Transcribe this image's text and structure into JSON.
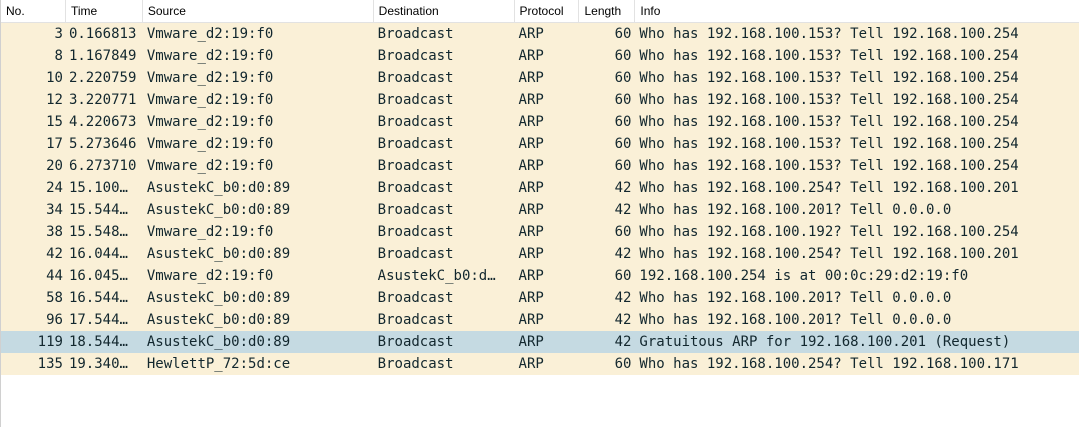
{
  "columns": {
    "no": "No.",
    "time": "Time",
    "source": "Source",
    "destination": "Destination",
    "protocol": "Protocol",
    "length": "Length",
    "info": "Info"
  },
  "packets": [
    {
      "no": "3",
      "time": "0.166813",
      "source": "Vmware_d2:19:f0",
      "destination": "Broadcast",
      "protocol": "ARP",
      "length": "60",
      "info": "Who has 192.168.100.153? Tell 192.168.100.254"
    },
    {
      "no": "8",
      "time": "1.167849",
      "source": "Vmware_d2:19:f0",
      "destination": "Broadcast",
      "protocol": "ARP",
      "length": "60",
      "info": "Who has 192.168.100.153? Tell 192.168.100.254"
    },
    {
      "no": "10",
      "time": "2.220759",
      "source": "Vmware_d2:19:f0",
      "destination": "Broadcast",
      "protocol": "ARP",
      "length": "60",
      "info": "Who has 192.168.100.153? Tell 192.168.100.254"
    },
    {
      "no": "12",
      "time": "3.220771",
      "source": "Vmware_d2:19:f0",
      "destination": "Broadcast",
      "protocol": "ARP",
      "length": "60",
      "info": "Who has 192.168.100.153? Tell 192.168.100.254"
    },
    {
      "no": "15",
      "time": "4.220673",
      "source": "Vmware_d2:19:f0",
      "destination": "Broadcast",
      "protocol": "ARP",
      "length": "60",
      "info": "Who has 192.168.100.153? Tell 192.168.100.254"
    },
    {
      "no": "17",
      "time": "5.273646",
      "source": "Vmware_d2:19:f0",
      "destination": "Broadcast",
      "protocol": "ARP",
      "length": "60",
      "info": "Who has 192.168.100.153? Tell 192.168.100.254"
    },
    {
      "no": "20",
      "time": "6.273710",
      "source": "Vmware_d2:19:f0",
      "destination": "Broadcast",
      "protocol": "ARP",
      "length": "60",
      "info": "Who has 192.168.100.153? Tell 192.168.100.254"
    },
    {
      "no": "24",
      "time": "15.100…",
      "source": "AsustekC_b0:d0:89",
      "destination": "Broadcast",
      "protocol": "ARP",
      "length": "42",
      "info": "Who has 192.168.100.254? Tell 192.168.100.201"
    },
    {
      "no": "34",
      "time": "15.544…",
      "source": "AsustekC_b0:d0:89",
      "destination": "Broadcast",
      "protocol": "ARP",
      "length": "42",
      "info": "Who has 192.168.100.201? Tell 0.0.0.0"
    },
    {
      "no": "38",
      "time": "15.548…",
      "source": "Vmware_d2:19:f0",
      "destination": "Broadcast",
      "protocol": "ARP",
      "length": "60",
      "info": "Who has 192.168.100.192? Tell 192.168.100.254"
    },
    {
      "no": "42",
      "time": "16.044…",
      "source": "AsustekC_b0:d0:89",
      "destination": "Broadcast",
      "protocol": "ARP",
      "length": "42",
      "info": "Who has 192.168.100.254? Tell 192.168.100.201"
    },
    {
      "no": "44",
      "time": "16.045…",
      "source": "Vmware_d2:19:f0",
      "destination": "AsustekC_b0:d…",
      "protocol": "ARP",
      "length": "60",
      "info": "192.168.100.254 is at 00:0c:29:d2:19:f0"
    },
    {
      "no": "58",
      "time": "16.544…",
      "source": "AsustekC_b0:d0:89",
      "destination": "Broadcast",
      "protocol": "ARP",
      "length": "42",
      "info": "Who has 192.168.100.201? Tell 0.0.0.0"
    },
    {
      "no": "96",
      "time": "17.544…",
      "source": "AsustekC_b0:d0:89",
      "destination": "Broadcast",
      "protocol": "ARP",
      "length": "42",
      "info": "Who has 192.168.100.201? Tell 0.0.0.0"
    },
    {
      "no": "119",
      "time": "18.544…",
      "source": "AsustekC_b0:d0:89",
      "destination": "Broadcast",
      "protocol": "ARP",
      "length": "42",
      "info": "Gratuitous ARP for 192.168.100.201 (Request)",
      "selected": true
    },
    {
      "no": "135",
      "time": "19.340…",
      "source": "HewlettP_72:5d:ce",
      "destination": "Broadcast",
      "protocol": "ARP",
      "length": "60",
      "info": "Who has 192.168.100.254? Tell 192.168.100.171"
    }
  ],
  "colors": {
    "row_arp": "#faf0d7",
    "row_selected": "#c5dae2",
    "row_text": "#12272e"
  }
}
